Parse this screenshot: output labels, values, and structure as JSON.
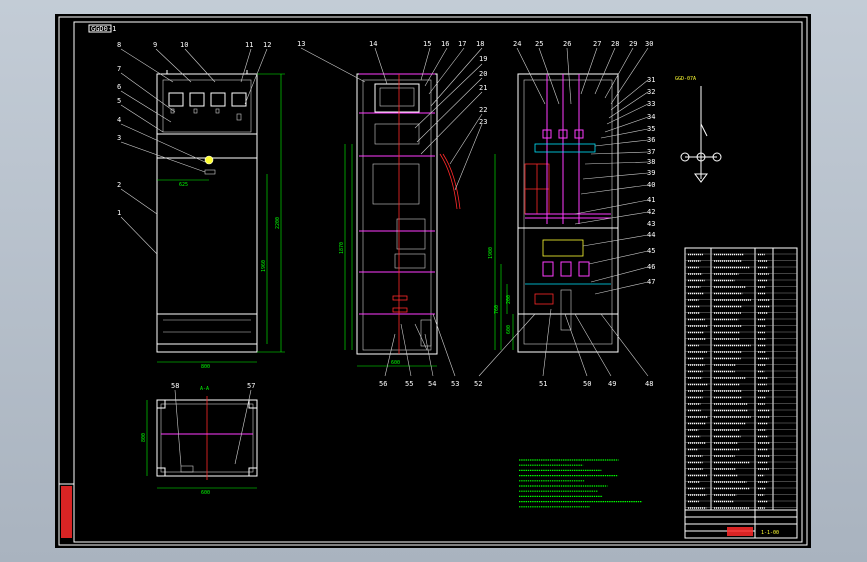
{
  "title_block": {
    "tag_top_left": "GGD0-1",
    "scheme_label": "GGD-07A",
    "drawing_no": "1-1-00"
  },
  "callouts_front": [
    "8",
    "9",
    "10",
    "11",
    "12",
    "7",
    "6",
    "5",
    "4",
    "3",
    "2",
    "1"
  ],
  "callouts_side": [
    "13",
    "14",
    "15",
    "16",
    "17",
    "18",
    "19",
    "20",
    "21",
    "22",
    "23",
    "56",
    "55",
    "54",
    "53"
  ],
  "callouts_rear": [
    "24",
    "25",
    "26",
    "27",
    "28",
    "29",
    "30",
    "31",
    "32",
    "33",
    "34",
    "35",
    "36",
    "37",
    "38",
    "39",
    "40",
    "41",
    "42",
    "43",
    "44",
    "45",
    "46",
    "47",
    "48",
    "49",
    "50",
    "51",
    "52"
  ],
  "callouts_plan": [
    "58",
    "57"
  ],
  "dimensions": {
    "front_width": "800",
    "front_height": "2200",
    "front_inner": "1960",
    "front_625": "625",
    "side_depth": "600",
    "plan_width": "600",
    "plan_depth": "800",
    "side_1870": "1870",
    "rear_1900": "1900",
    "rear_760": "760",
    "rear_200": "200",
    "rear_600": "600",
    "section": "A-A"
  },
  "colors": {
    "sheet_bg": "#000000",
    "outline": "#ffffff",
    "dimension": "#00ff00",
    "busbar": "#ff3cff",
    "centerline": "#ff2a2a",
    "title_bar": "#ff2a2a"
  }
}
